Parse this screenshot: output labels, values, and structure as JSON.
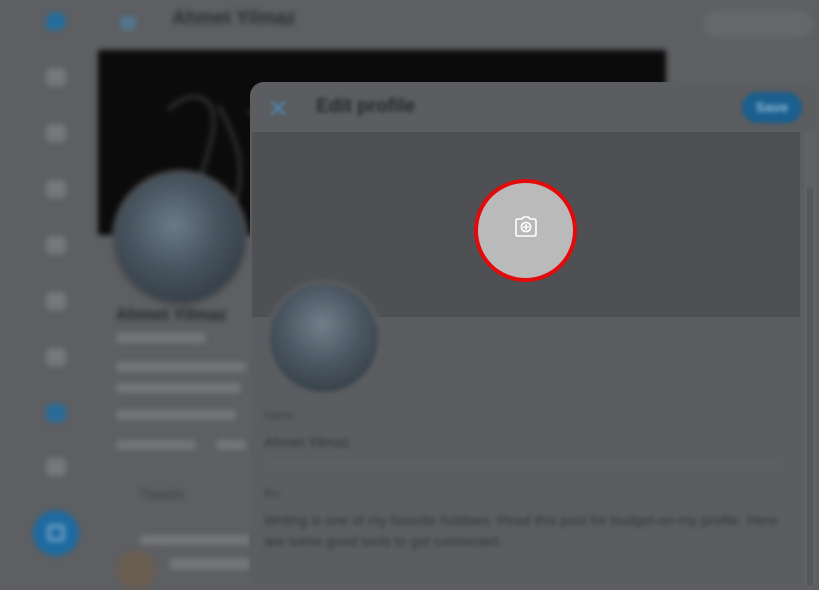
{
  "page": {
    "title": "Ahmet Yilmaz"
  },
  "profile": {
    "name": "Ahmet Yilmaz",
    "tabs": [
      "Tweets"
    ]
  },
  "modal": {
    "title": "Edit profile",
    "save_label": "Save",
    "name_label": "Name",
    "name_value": "Ahmet Yilmaz",
    "bio_label": "Bio",
    "bio_value": "Writing is one of my favorite hobbies. Read this post for budget-on-my profile. Here are some good tools to get connected."
  },
  "icons": {
    "close": "close-icon",
    "camera": "add-photo-camera-icon"
  },
  "colors": {
    "highlight_ring": "#e20a0a",
    "camera_button": "#bababa",
    "accent": "#1d9bf0"
  }
}
